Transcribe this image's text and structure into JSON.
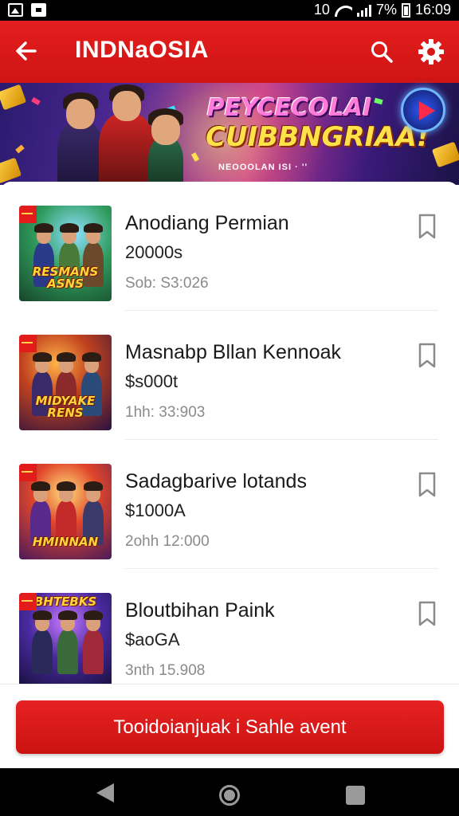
{
  "status_bar": {
    "battery": "7%",
    "time": "16:09",
    "network_label": "10"
  },
  "app_bar": {
    "title": "INDNaOSIA"
  },
  "banner": {
    "title_line1": "PEYCECOLAI",
    "title_line2": "CUIBBNGRIAA!",
    "subtitle": "NEOOOLAN ISI  ·  ''"
  },
  "items": [
    {
      "title": "Anodiang Permian",
      "price": "20000s",
      "meta": "Sob: S3:026",
      "thumb_text": "RESMANS ASNS",
      "theme": "green"
    },
    {
      "title": "Masnabp Bllan Kennoak",
      "price": "$s000t",
      "meta": "1hh: 33:903",
      "thumb_text": "MIDYAKE RENS",
      "theme": "orange"
    },
    {
      "title": "Sadagbarive lotands",
      "price": "$1000A",
      "meta": "2ohh 12:000",
      "thumb_text": "HMINNAN",
      "theme": "red"
    },
    {
      "title": "Bloutbihan Paink",
      "price": "$aoGA",
      "meta": "3nth 15.908",
      "thumb_text": "BHTEBKS",
      "theme": "purple"
    }
  ],
  "cta": {
    "label": "Tooidoianjuak i Sahle avent"
  },
  "colors": {
    "brand_red": "#e41e1e",
    "text_dark": "#1a1a1a",
    "text_muted": "#8a8a8a"
  },
  "icons": [
    "back-arrow-icon",
    "search-icon",
    "gear-icon",
    "play-icon",
    "bookmark-icon",
    "nav-back-icon",
    "nav-home-icon",
    "nav-recent-icon"
  ]
}
